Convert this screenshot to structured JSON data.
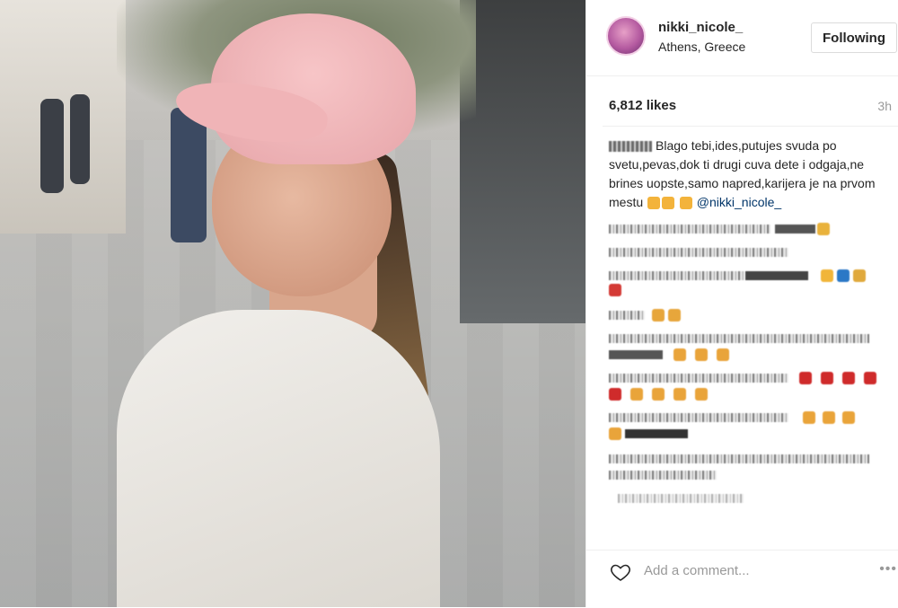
{
  "post": {
    "username": "nikki_nicole_",
    "location": "Athens, Greece",
    "follow_label": "Following",
    "likes": "6,812 likes",
    "time": "3h"
  },
  "caption": {
    "text": "Blago tebi,ides,putujes svuda po svetu,pevas,dok ti drugi cuva dete i odgaja,ne brines uopste,samo napred,karijera je na prvom mestu",
    "mention": "@nikki_nicole_"
  },
  "comment_box": {
    "placeholder": "Add a comment...",
    "more_label": "•••"
  },
  "icons": [
    "heart-icon",
    "thumbs-up-icon",
    "more-options-icon"
  ],
  "colors": {
    "mention": "#003569",
    "text": "#262626",
    "muted": "#999999",
    "border": "#dbdbdb"
  }
}
